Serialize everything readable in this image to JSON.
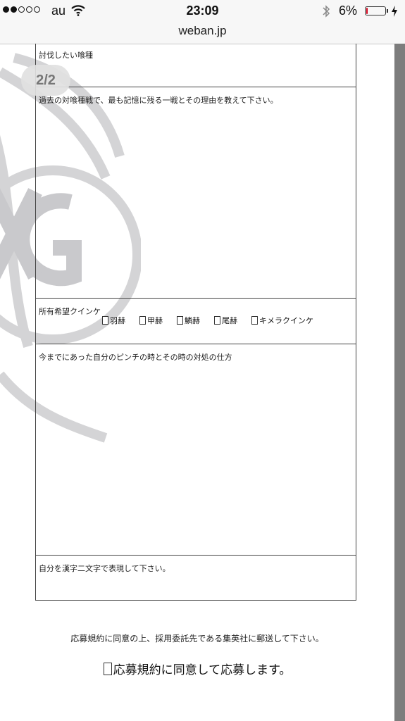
{
  "status_bar": {
    "carrier": "au",
    "time": "23:09",
    "battery_percent": "6%",
    "signal_strength": 2,
    "battery_level": 0.06,
    "battery_color": "#d0021b"
  },
  "browser": {
    "url": "weban.jp"
  },
  "pager": {
    "label": "2/2"
  },
  "form": {
    "sections": [
      {
        "label": "討伐したい喰種"
      },
      {
        "label": "過去の対喰種戦で、最も記憶に残る一戦とその理由を教えて下さい。"
      },
      {
        "label": "所有希望クインケ",
        "options": [
          "羽赫",
          "甲赫",
          "鱗赫",
          "尾赫",
          "キメラクインケ"
        ]
      },
      {
        "label": "今までにあった自分のピンチの時とその時の対処の仕方"
      },
      {
        "label": "自分を漢字二文字で表現して下さい。"
      }
    ]
  },
  "footer": {
    "notice": "応募規約に同意の上、採用委託先である集英社に郵送して下さい。",
    "agree_label": "応募規約に同意して応募します。"
  },
  "colors": {
    "border": "#444444",
    "scrollbar": "#7d7d7d",
    "watermark": "#d4d4d6"
  },
  "icons": [
    "wifi-icon",
    "bluetooth-icon",
    "battery-icon",
    "charging-icon",
    "watermark-emblem",
    "checkbox-icon"
  ]
}
